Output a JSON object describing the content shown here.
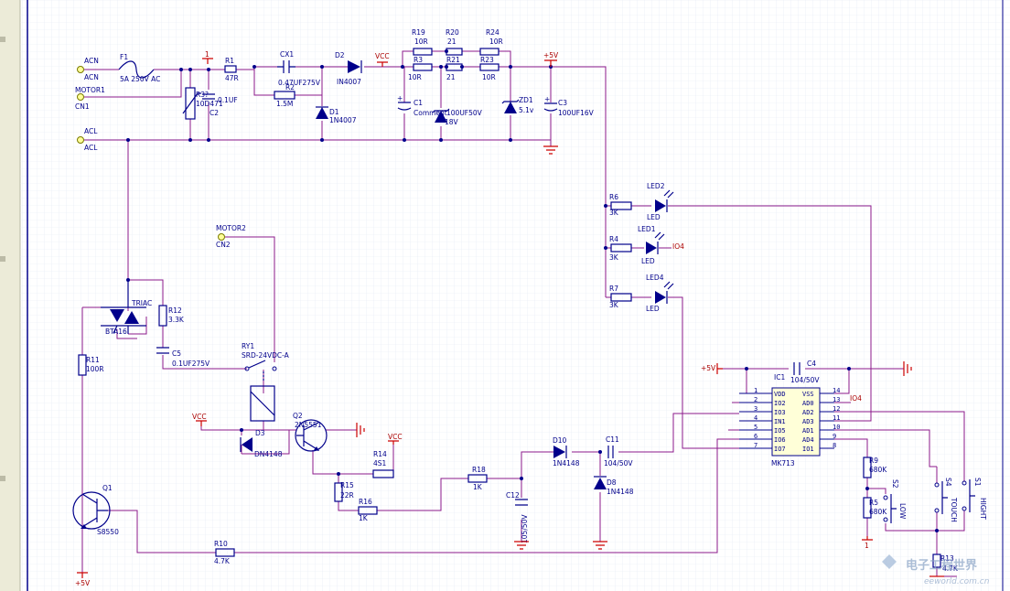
{
  "colors": {
    "wire": "#8b1a8b",
    "component": "#00008b",
    "net_label": "#aa0000",
    "grid": "#e3e9f4",
    "sheet_border": "#00008b",
    "left_panel": "#ecebd8"
  },
  "connectors": {
    "acn_a": "ACN",
    "acn_b": "ACN",
    "motor1": "MOTOR1",
    "cn1": "CN1",
    "acl_a": "ACL",
    "acl_b": "ACL",
    "motor2": "MOTOR2",
    "cn2": "CN2"
  },
  "components": {
    "f1": {
      "ref": "F1",
      "value": "5A 250V AC"
    },
    "rv": {
      "ref": "R3?",
      "value": "10D471"
    },
    "c2": {
      "ref": "C2",
      "value": "0.1UF"
    },
    "r1": {
      "ref": "R1",
      "value": "47R"
    },
    "cx1": {
      "ref": "CX1",
      "value": "0.47UF275V"
    },
    "r2": {
      "ref": "R2",
      "value": "1.5M"
    },
    "d2": {
      "ref": "D2",
      "value": "IN4007"
    },
    "d1": {
      "ref": "D1",
      "value": "1N4007"
    },
    "r19": {
      "ref": "R19",
      "value": "10R"
    },
    "r20": {
      "ref": "R20",
      "value": "21"
    },
    "r24": {
      "ref": "R24",
      "value": "10R"
    },
    "r3": {
      "ref": "R3",
      "value": "10R"
    },
    "r21": {
      "ref": "R21",
      "value": "21"
    },
    "r23": {
      "ref": "R23",
      "value": "10R"
    },
    "c1": {
      "ref": "C1",
      "value": "Comment"
    },
    "zd_mid": {
      "ref": "",
      "value": "100UF50V"
    },
    "zd_18": {
      "ref": "",
      "value": "18V"
    },
    "zd1": {
      "ref": "ZD1",
      "value": "5.1v"
    },
    "c3": {
      "ref": "C3",
      "value": "100UF16V"
    },
    "r6": {
      "ref": "R6",
      "value": "3K"
    },
    "r4": {
      "ref": "R4",
      "value": "3K"
    },
    "r7": {
      "ref": "R7",
      "value": "3K"
    },
    "led2": {
      "ref": "LED2",
      "value": "LED"
    },
    "led1": {
      "ref": "LED1",
      "value": "LED"
    },
    "led4": {
      "ref": "LED4",
      "value": "LED"
    },
    "triac": {
      "ref": "TRIAC",
      "value": "BTA16"
    },
    "r12": {
      "ref": "R12",
      "value": "3.3K"
    },
    "c5": {
      "ref": "C5",
      "value": "0.1UF275V"
    },
    "r11": {
      "ref": "R11",
      "value": "100R"
    },
    "rly": {
      "ref": "RY1",
      "value": "SRD-24VDC-A"
    },
    "d3": {
      "ref": "D3",
      "value": "DN4148"
    },
    "q2": {
      "ref": "Q2",
      "value": "2N5551"
    },
    "r14": {
      "ref": "R14",
      "value": "4S1"
    },
    "r15": {
      "ref": "R15",
      "value": "22R"
    },
    "r16": {
      "ref": "R16",
      "value": "1K"
    },
    "r18": {
      "ref": "R18",
      "value": "1K"
    },
    "c12": {
      "ref": "C12",
      "value": "105/50V"
    },
    "d10": {
      "ref": "D10",
      "value": "1N4148"
    },
    "c11": {
      "ref": "C11",
      "value": "104/50V"
    },
    "d8": {
      "ref": "D8",
      "value": "1N4148"
    },
    "q1": {
      "ref": "Q1",
      "value": "S8550"
    },
    "r10": {
      "ref": "R10",
      "value": "4.7K"
    },
    "c4": {
      "ref": "C4",
      "value": "104/50V"
    },
    "r9": {
      "ref": "R9",
      "value": "680K"
    },
    "r5": {
      "ref": "R5",
      "value": "680K"
    },
    "r13": {
      "ref": "R13",
      "value": "4.7K"
    },
    "s2": {
      "ref": "S2",
      "value": "LOW"
    },
    "s4": {
      "ref": "S4",
      "value": "TOUCH"
    },
    "s1": {
      "ref": "S1",
      "value": "HIGHT"
    }
  },
  "ic1": {
    "ref": "IC1",
    "name": "MK713",
    "left_pins": [
      {
        "num": "1",
        "name": "VDD"
      },
      {
        "num": "2",
        "name": "IO2"
      },
      {
        "num": "3",
        "name": "IO3"
      },
      {
        "num": "4",
        "name": "IN1"
      },
      {
        "num": "5",
        "name": "IO5"
      },
      {
        "num": "6",
        "name": "IO6"
      },
      {
        "num": "7",
        "name": "IO7"
      }
    ],
    "right_pins": [
      {
        "num": "14",
        "name": "VSS"
      },
      {
        "num": "13",
        "name": "AD0"
      },
      {
        "num": "12",
        "name": "AD2"
      },
      {
        "num": "11",
        "name": "AD3"
      },
      {
        "num": "10",
        "name": "AD1"
      },
      {
        "num": "9",
        "name": "AD4"
      },
      {
        "num": "8",
        "name": "IO1"
      }
    ]
  },
  "nets": {
    "vcc_top": "VCC",
    "plus5_top": "+5V",
    "ground1": "1",
    "vcc_relay": "VCC",
    "vcc_q2": "VCC",
    "plus5_c4": "+5V",
    "io4_led": "IO4",
    "io4_ic": "IO4",
    "plus5_bottom": "+5V",
    "ground2": "1"
  },
  "watermark": {
    "logo": "电子工程世界",
    "url": "eeworld.com.cn"
  }
}
